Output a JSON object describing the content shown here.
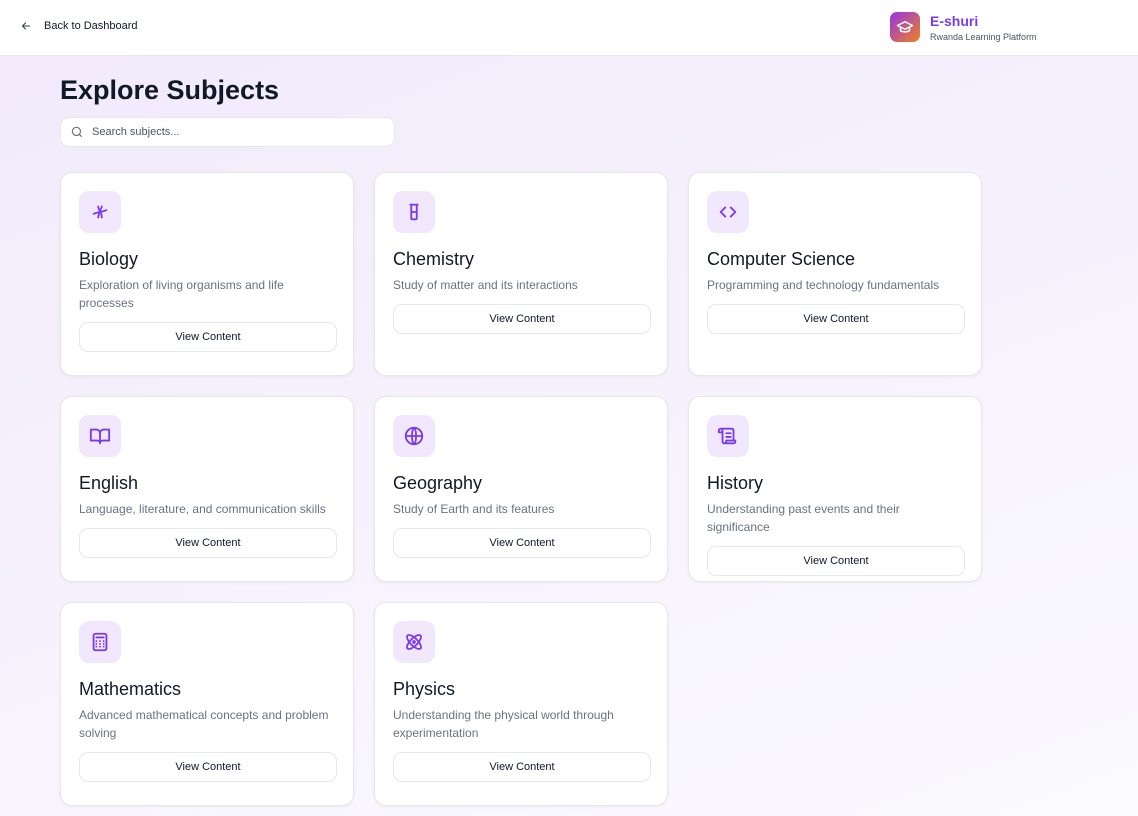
{
  "header": {
    "back_label": "Back to Dashboard",
    "brand_name": "E-shuri",
    "brand_tagline": "Rwanda Learning Platform"
  },
  "page": {
    "title": "Explore Subjects",
    "search_placeholder": "Search subjects..."
  },
  "accent": "#7c3aed",
  "subjects": [
    {
      "name": "Biology",
      "description": "Exploration of living organisms and life processes",
      "icon": "dna-icon",
      "button": "View Content"
    },
    {
      "name": "Chemistry",
      "description": "Study of matter and its interactions",
      "icon": "beaker-icon",
      "button": "View Content"
    },
    {
      "name": "Computer Science",
      "description": "Programming and technology fundamentals",
      "icon": "code-icon",
      "button": "View Content"
    },
    {
      "name": "English",
      "description": "Language, literature, and communication skills",
      "icon": "book-open-icon",
      "button": "View Content"
    },
    {
      "name": "Geography",
      "description": "Study of Earth and its features",
      "icon": "globe-icon",
      "button": "View Content"
    },
    {
      "name": "History",
      "description": "Understanding past events and their significance",
      "icon": "scroll-icon",
      "button": "View Content"
    },
    {
      "name": "Mathematics",
      "description": "Advanced mathematical concepts and problem solving",
      "icon": "calculator-icon",
      "button": "View Content"
    },
    {
      "name": "Physics",
      "description": "Understanding the physical world through experimentation",
      "icon": "atom-icon",
      "button": "View Content"
    }
  ]
}
